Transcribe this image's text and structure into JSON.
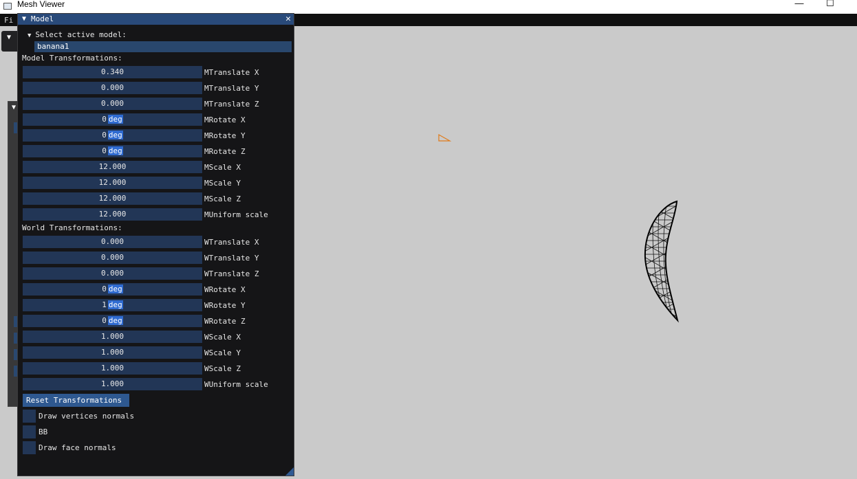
{
  "window": {
    "title": "Mesh Viewer",
    "minimize_glyph": "—",
    "maximize_glyph": "☐"
  },
  "menubar": {
    "first_item": "Fi"
  },
  "panel": {
    "title": "Model",
    "close_glyph": "✕",
    "collapse_glyph": "▼",
    "select_header": "Select active model:",
    "active_model": "banana1",
    "model_section": "Model Transformations:",
    "model_fields": [
      {
        "value": "0.340",
        "unit": "",
        "label": "MTranslate X"
      },
      {
        "value": "0.000",
        "unit": "",
        "label": "MTranslate Y"
      },
      {
        "value": "0.000",
        "unit": "",
        "label": "MTranslate Z"
      },
      {
        "value": "0",
        "unit": "deg",
        "label": "MRotate X"
      },
      {
        "value": "0",
        "unit": "deg",
        "label": "MRotate Y"
      },
      {
        "value": "0",
        "unit": "deg",
        "label": "MRotate Z"
      },
      {
        "value": "12.000",
        "unit": "",
        "label": "MScale X"
      },
      {
        "value": "12.000",
        "unit": "",
        "label": "MScale Y"
      },
      {
        "value": "12.000",
        "unit": "",
        "label": "MScale Z"
      },
      {
        "value": "12.000",
        "unit": "",
        "label": "MUniform scale"
      }
    ],
    "world_section": "World Transformations:",
    "world_fields": [
      {
        "value": "0.000",
        "unit": "",
        "label": "WTranslate X"
      },
      {
        "value": "0.000",
        "unit": "",
        "label": "WTranslate Y"
      },
      {
        "value": "0.000",
        "unit": "",
        "label": "WTranslate Z"
      },
      {
        "value": "0",
        "unit": "deg",
        "label": "WRotate X"
      },
      {
        "value": "1",
        "unit": "deg",
        "label": "WRotate Y"
      },
      {
        "value": "0",
        "unit": "deg",
        "label": "WRotate Z"
      },
      {
        "value": "1.000",
        "unit": "",
        "label": "WScale X"
      },
      {
        "value": "1.000",
        "unit": "",
        "label": "WScale Y"
      },
      {
        "value": "1.000",
        "unit": "",
        "label": "WScale Z"
      },
      {
        "value": "1.000",
        "unit": "",
        "label": "WUniform scale"
      }
    ],
    "reset_button": "Reset Transformations",
    "checkboxes": [
      {
        "label": "Draw vertices normals",
        "checked": false
      },
      {
        "label": "BB",
        "checked": false
      },
      {
        "label": "Draw face normals",
        "checked": false
      }
    ]
  },
  "colors": {
    "accent": "#2f6bd1",
    "header": "#294a7a",
    "frame_bg": "#223656",
    "viewport": "#cacaca",
    "camera": "#e07b1a"
  }
}
